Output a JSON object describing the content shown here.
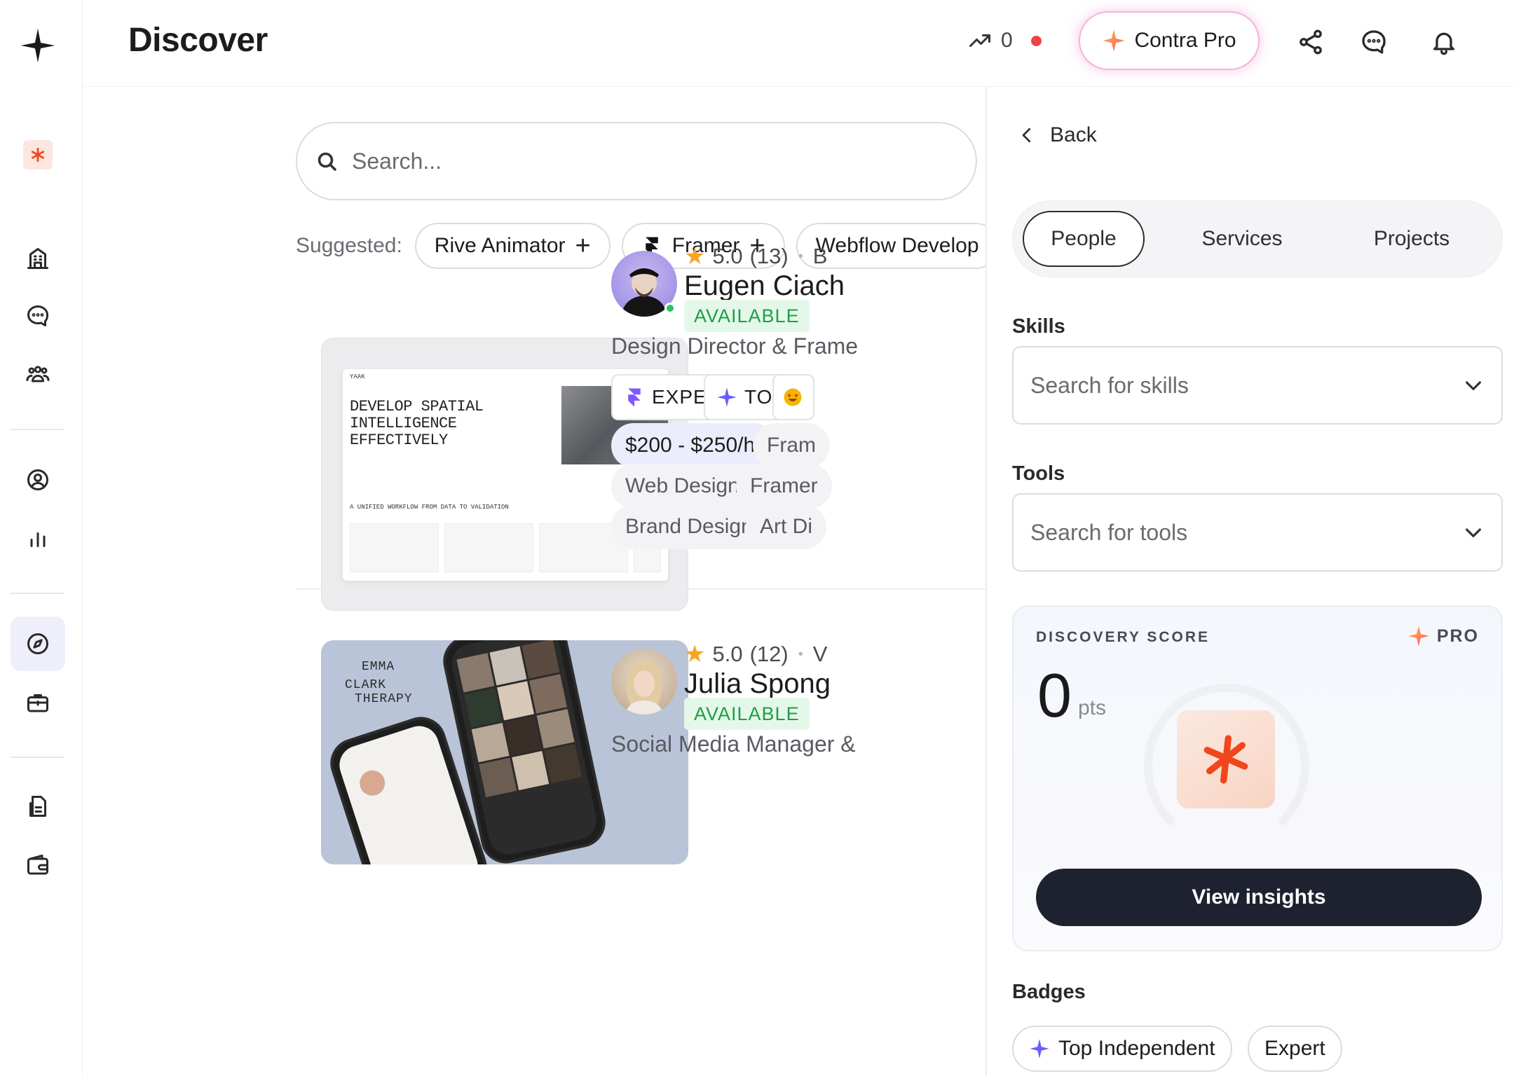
{
  "header": {
    "title": "Discover",
    "trend_value": "0",
    "pro_button_label": "Contra Pro"
  },
  "sidebar": {
    "icons": [
      "contra-logo-icon",
      "asterisk-brand-icon",
      "building-icon",
      "chat-icon",
      "community-icon",
      "profile-icon",
      "analytics-icon",
      "compass-icon",
      "briefcase-icon",
      "document-icon",
      "wallet-icon"
    ],
    "active": "compass-icon"
  },
  "search": {
    "placeholder": "Search..."
  },
  "suggested": {
    "label": "Suggested:",
    "chips": [
      "Rive Animator",
      "Framer",
      "Webflow Develop"
    ]
  },
  "cards": [
    {
      "rating": "5.0",
      "reviews": "(13)",
      "location_initial": "B",
      "name": "Eugen Ciach",
      "status": "AVAILABLE",
      "role": "Design Director & Frame",
      "badges": [
        "EXPERT",
        "TOP"
      ],
      "rate": "$200 - $250/hr",
      "tags": [
        "Fram",
        "Web Designer",
        "Framer",
        "Brand Designer",
        "Art Di"
      ],
      "thumb": {
        "brand": "YAAK",
        "headline": "DEVELOP SPATIAL INTELLIGENCE EFFECTIVELY",
        "subhead": "A UNIFIED WORKFLOW FROM DATA TO VALIDATION"
      }
    },
    {
      "rating": "5.0",
      "reviews": "(12)",
      "location_initial": "V",
      "name": "Julia Spong",
      "status": "AVAILABLE",
      "role": "Social Media Manager &",
      "thumb": {
        "brand_lines": [
          "EMMA",
          "CLARK",
          "THERAPY"
        ]
      }
    }
  ],
  "panel": {
    "back_label": "Back",
    "tabs": [
      "People",
      "Services",
      "Projects"
    ],
    "active_tab": "People",
    "skills_label": "Skills",
    "skills_placeholder": "Search for skills",
    "tools_label": "Tools",
    "tools_placeholder": "Search for tools",
    "score": {
      "label": "DISCOVERY SCORE",
      "pro_label": "PRO",
      "value": "0",
      "unit": "pts",
      "button": "View insights"
    },
    "badges_label": "Badges",
    "badges": [
      "Top Independent",
      "Expert"
    ]
  },
  "colors": {
    "accent": "#ff4f1f",
    "available_green": "#1f9d47",
    "dark_button": "#1e2230",
    "active_nav": "#efeffb"
  }
}
